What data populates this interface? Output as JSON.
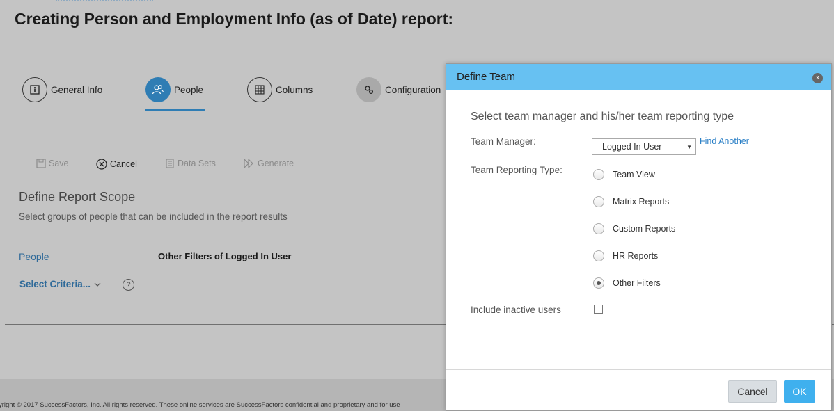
{
  "page": {
    "title": "Creating Person and Employment Info (as of Date) report:"
  },
  "stepper": {
    "steps": [
      {
        "label": "General Info",
        "icon": "info-icon"
      },
      {
        "label": "People",
        "icon": "people-icon",
        "active": true
      },
      {
        "label": "Columns",
        "icon": "grid-icon"
      },
      {
        "label": "Configuration",
        "icon": "gears-icon"
      }
    ]
  },
  "toolbar": {
    "save_label": "Save",
    "cancel_label": "Cancel",
    "datasets_label": "Data Sets",
    "generate_label": "Generate"
  },
  "scope": {
    "title": "Define Report Scope",
    "subtitle": "Select groups of people that can be included in the report results",
    "people_link": "People",
    "other_filters": "Other Filters of Logged In User",
    "select_criteria": "Select Criteria...",
    "help": "?"
  },
  "footer": {
    "prefix": "yright © ",
    "company": "2017 SuccessFactors, Inc.",
    "text": " All rights reserved. These online services are SuccessFactors confidential and proprietary and for use"
  },
  "dialog": {
    "title": "Define Team",
    "close": "×",
    "subtitle": "Select team manager and his/her team reporting type",
    "manager_label": "Team Manager:",
    "manager_value": "Logged In User",
    "find_another": "Find Another",
    "reporting_type_label": "Team Reporting Type:",
    "options": [
      {
        "label": "Team View",
        "selected": false
      },
      {
        "label": "Matrix Reports",
        "selected": false
      },
      {
        "label": "Custom Reports",
        "selected": false
      },
      {
        "label": "HR Reports",
        "selected": false
      },
      {
        "label": "Other Filters",
        "selected": true
      }
    ],
    "inactive_label": "Include inactive users",
    "inactive_checked": false,
    "cancel_label": "Cancel",
    "ok_label": "OK"
  },
  "colors": {
    "header_blue": "#67c1f2",
    "ok_blue": "#3fb0ee",
    "link_blue": "#2a7fc6",
    "active_step": "#2f7db4"
  }
}
